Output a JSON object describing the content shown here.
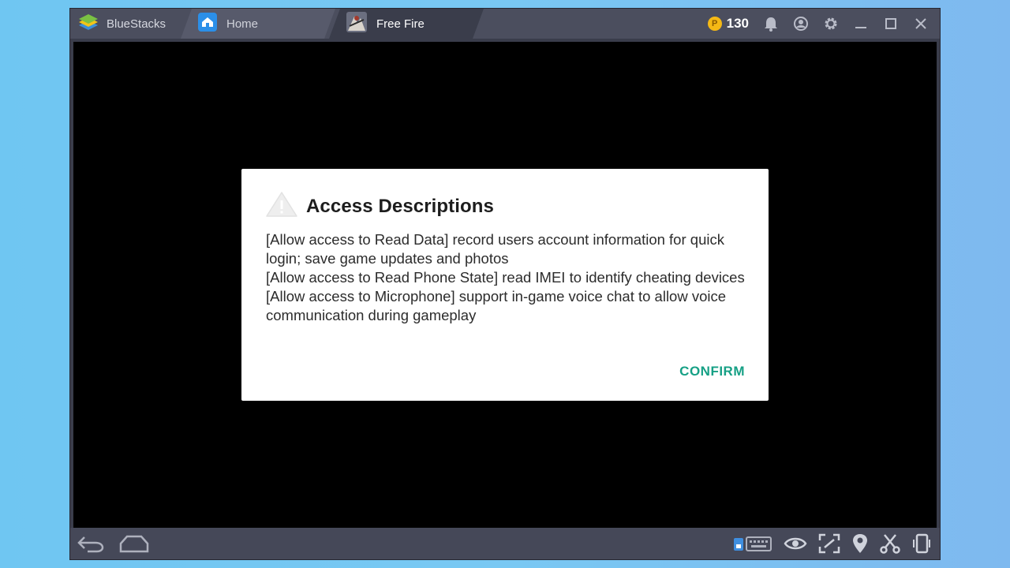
{
  "app": {
    "name": "BlueStacks",
    "tabs": [
      {
        "label": "Home"
      },
      {
        "label": "Free Fire"
      }
    ],
    "coins": "130",
    "coin_symbol": "P"
  },
  "dialog": {
    "title": "Access Descriptions",
    "paragraphs": [
      "[Allow access to Read Data] record users account information for quick login; save game updates and photos",
      "[Allow access to Read Phone State] read IMEI to identify cheating devices",
      "[Allow access to Microphone] support in-game voice chat to allow voice communication during gameplay"
    ],
    "confirm_label": "CONFIRM"
  },
  "colors": {
    "confirm": "#16a085",
    "coin": "#f5b915"
  },
  "icons": {
    "top_bar": [
      "bluestacks-logo-icon",
      "home-tab-icon",
      "free-fire-tab-icon",
      "coin-icon",
      "bell-icon",
      "account-icon",
      "gear-icon",
      "minimize-icon",
      "maximize-icon",
      "close-icon"
    ],
    "dialog": [
      "warning-icon"
    ],
    "bottom_bar": [
      "back-icon",
      "home-icon",
      "keyboard-icon",
      "eye-icon",
      "fullscreen-icon",
      "location-icon",
      "scissors-icon",
      "phone-rotate-icon"
    ]
  }
}
